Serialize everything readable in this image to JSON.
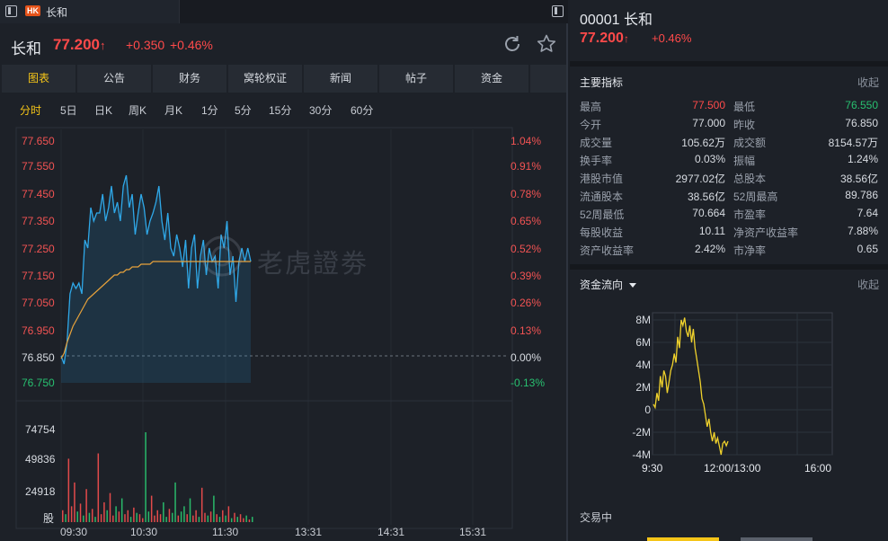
{
  "tab": {
    "badge": "HK",
    "name": "长和"
  },
  "quote": {
    "name": "长和",
    "price": "77.200",
    "change": "+0.350",
    "change_pct": "+0.46%",
    "code_title": "00001 长和",
    "up_color": "#ff4a4a",
    "down_color": "#28c070"
  },
  "nav_tabs": [
    "图表",
    "公告",
    "财务",
    "窝轮权证",
    "新闻",
    "帖子",
    "资金"
  ],
  "periods": [
    "分时",
    "5日",
    "日K",
    "周K",
    "月K",
    "1分",
    "5分",
    "15分",
    "30分",
    "60分"
  ],
  "watermark": "老虎證劵",
  "chart_data": [
    {
      "type": "line",
      "title": "",
      "x_ticks": [
        "09:30",
        "10:30",
        "11:30",
        "13:31",
        "14:31",
        "15:31"
      ],
      "y_ticks_price": [
        "77.650",
        "77.550",
        "77.450",
        "77.350",
        "77.250",
        "77.150",
        "77.050",
        "76.950",
        "76.850",
        "76.750"
      ],
      "y_ticks_pct": [
        "1.04%",
        "0.91%",
        "0.78%",
        "0.65%",
        "0.52%",
        "0.39%",
        "0.26%",
        "0.13%",
        "0.00%",
        "-0.13%"
      ],
      "prev_close": 76.85,
      "series": [
        {
          "name": "price",
          "values": [
            76.85,
            76.82,
            76.9,
            77.08,
            77.12,
            77.1,
            77.12,
            77.08,
            77.28,
            77.25,
            77.4,
            77.35,
            77.38,
            77.38,
            77.45,
            77.35,
            77.4,
            77.48,
            77.38,
            77.42,
            77.35,
            77.48,
            77.52,
            77.4,
            77.45,
            77.3,
            77.38,
            77.45,
            77.4,
            77.3,
            77.35,
            77.38,
            77.42,
            77.48,
            77.35,
            77.28,
            77.38,
            77.25,
            77.22,
            77.3,
            77.25,
            77.18,
            77.28,
            77.1,
            77.25,
            77.3,
            77.1,
            77.22,
            77.28,
            77.15,
            77.25,
            77.2,
            77.22,
            77.1,
            77.3,
            77.25,
            77.35,
            77.15,
            77.22,
            77.05,
            77.2,
            77.25,
            77.2,
            77.25,
            77.2
          ]
        },
        {
          "name": "avg",
          "values": [
            76.84,
            76.86,
            76.9,
            76.93,
            76.96,
            76.98,
            77.0,
            77.02,
            77.04,
            77.06,
            77.07,
            77.08,
            77.09,
            77.1,
            77.11,
            77.12,
            77.13,
            77.14,
            77.15,
            77.15,
            77.16,
            77.16,
            77.17,
            77.17,
            77.18,
            77.18,
            77.18,
            77.19,
            77.19,
            77.19,
            77.19,
            77.2,
            77.2,
            77.2,
            77.2,
            77.2,
            77.2,
            77.2,
            77.2,
            77.2,
            77.2,
            77.2,
            77.2,
            77.2,
            77.2,
            77.2,
            77.2,
            77.2,
            77.2,
            77.2,
            77.2,
            77.2,
            77.2,
            77.2,
            77.2,
            77.2,
            77.2,
            77.2,
            77.2,
            77.2,
            77.2,
            77.2,
            77.2,
            77.2,
            77.2
          ]
        }
      ]
    },
    {
      "type": "bar",
      "title": "",
      "y_ticks": [
        "74754",
        "49836",
        "24918",
        "股"
      ],
      "ylim": [
        0,
        85000
      ],
      "values": [
        9000,
        6000,
        48000,
        12000,
        30000,
        8000,
        14000,
        5000,
        25000,
        7000,
        10000,
        4000,
        52000,
        6000,
        15000,
        9000,
        22000,
        5000,
        12000,
        8000,
        18000,
        6000,
        9000,
        4000,
        11000,
        7000,
        6000,
        3000,
        68000,
        8000,
        20000,
        5000,
        9000,
        6000,
        15000,
        4000,
        10000,
        7000,
        30000,
        5000,
        8000,
        12000,
        6000,
        18000,
        5000,
        9000,
        4000,
        26000,
        7000,
        5000,
        8000,
        20000,
        6000,
        4000,
        9000,
        5000,
        12000,
        3000,
        7000,
        4000,
        6000,
        3000,
        5000,
        2000,
        4000
      ],
      "colors_note": "red when price up from previous minute, green when down"
    },
    {
      "type": "line",
      "title": "资金流向",
      "x_ticks": [
        "9:30",
        "12:00/13:00",
        "16:00"
      ],
      "y_ticks": [
        "8M",
        "6M",
        "4M",
        "2M",
        "0",
        "-2M",
        "-4M"
      ],
      "ylim": [
        -4,
        8
      ],
      "unit": "M",
      "series": [
        {
          "name": "资金流向",
          "values": [
            0.5,
            0.2,
            1.5,
            0.8,
            3.0,
            2.0,
            3.5,
            3.0,
            1.5,
            2.5,
            3.5,
            4.0,
            5.0,
            4.2,
            6.5,
            5.5,
            8.0,
            7.5,
            8.2,
            7.0,
            6.5,
            7.5,
            6.0,
            7.2,
            5.5,
            4.5,
            3.5,
            2.5,
            1.0,
            0.5,
            -0.5,
            -1.5,
            -0.8,
            -2.0,
            -2.8,
            -2.0,
            -3.0,
            -2.5,
            -3.2,
            -4.0,
            -3.0,
            -2.8,
            -3.2,
            -2.8
          ]
        }
      ]
    }
  ],
  "indicators": {
    "title": "主要指标",
    "collapse_label": "收起",
    "rows": [
      {
        "l": "最高",
        "lv": "77.500",
        "lc": "up",
        "r": "最低",
        "rv": "76.550",
        "rc": "down"
      },
      {
        "l": "今开",
        "lv": "77.000",
        "lc": "flat",
        "r": "昨收",
        "rv": "76.850",
        "rc": "flat"
      },
      {
        "l": "成交量",
        "lv": "105.62万",
        "lc": "flat",
        "r": "成交额",
        "rv": "8154.57万",
        "rc": "flat"
      },
      {
        "l": "换手率",
        "lv": "0.03%",
        "lc": "flat",
        "r": "振幅",
        "rv": "1.24%",
        "rc": "flat"
      },
      {
        "l": "港股市值",
        "lv": "2977.02亿",
        "lc": "flat",
        "r": "总股本",
        "rv": "38.56亿",
        "rc": "flat"
      },
      {
        "l": "流通股本",
        "lv": "38.56亿",
        "lc": "flat",
        "r": "52周最高",
        "rv": "89.786",
        "rc": "flat"
      },
      {
        "l": "52周最低",
        "lv": "70.664",
        "lc": "flat",
        "r": "市盈率",
        "rv": "7.64",
        "rc": "flat"
      },
      {
        "l": "每股收益",
        "lv": "10.11",
        "lc": "flat",
        "r": "净资产收益率",
        "rv": "7.88%",
        "rc": "flat"
      },
      {
        "l": "资产收益率",
        "lv": "2.42%",
        "lc": "flat",
        "r": "市净率",
        "rv": "0.65",
        "rc": "flat"
      }
    ]
  },
  "fund_flow": {
    "title": "资金流向",
    "collapse_label": "收起"
  },
  "status": "交易中"
}
